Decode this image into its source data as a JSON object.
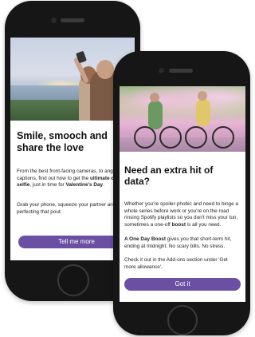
{
  "phone1": {
    "headline": "Smile, smooch and share the love",
    "para1_a": "From the best front-facing cameras, to ang",
    "para1_b": "captions, find out how to get the ",
    "para1_bold": "ultimate c",
    "para1_c": "selfie",
    "para1_d": ", just in time for ",
    "para1_bold2": "Valentine's Day",
    "para1_e": ".",
    "para2": "Grab your phone, squeeze your partner an perfecting that pout.",
    "cta_label": "Tell me more"
  },
  "phone2": {
    "headline": "Need an extra hit of data?",
    "para1": "Whether you're spoiler-phobic and need to binge a whole series before work or you're on the road rinsing Spotify playlists so you don't miss your tun, sometimes a one-off ",
    "para1_bold": "boost",
    "para1_end": " is all you need.",
    "para2_bold": "A One Day Boost",
    "para2": " gives you that short-term hit, ending at midnight. No scary bills. No stress.",
    "para3": "Check it out in the Add-ons section under 'Get more allowance'.",
    "cta_label": "Got it"
  },
  "colors": {
    "button": "#6a4fa2",
    "phone_body": "#161616"
  }
}
